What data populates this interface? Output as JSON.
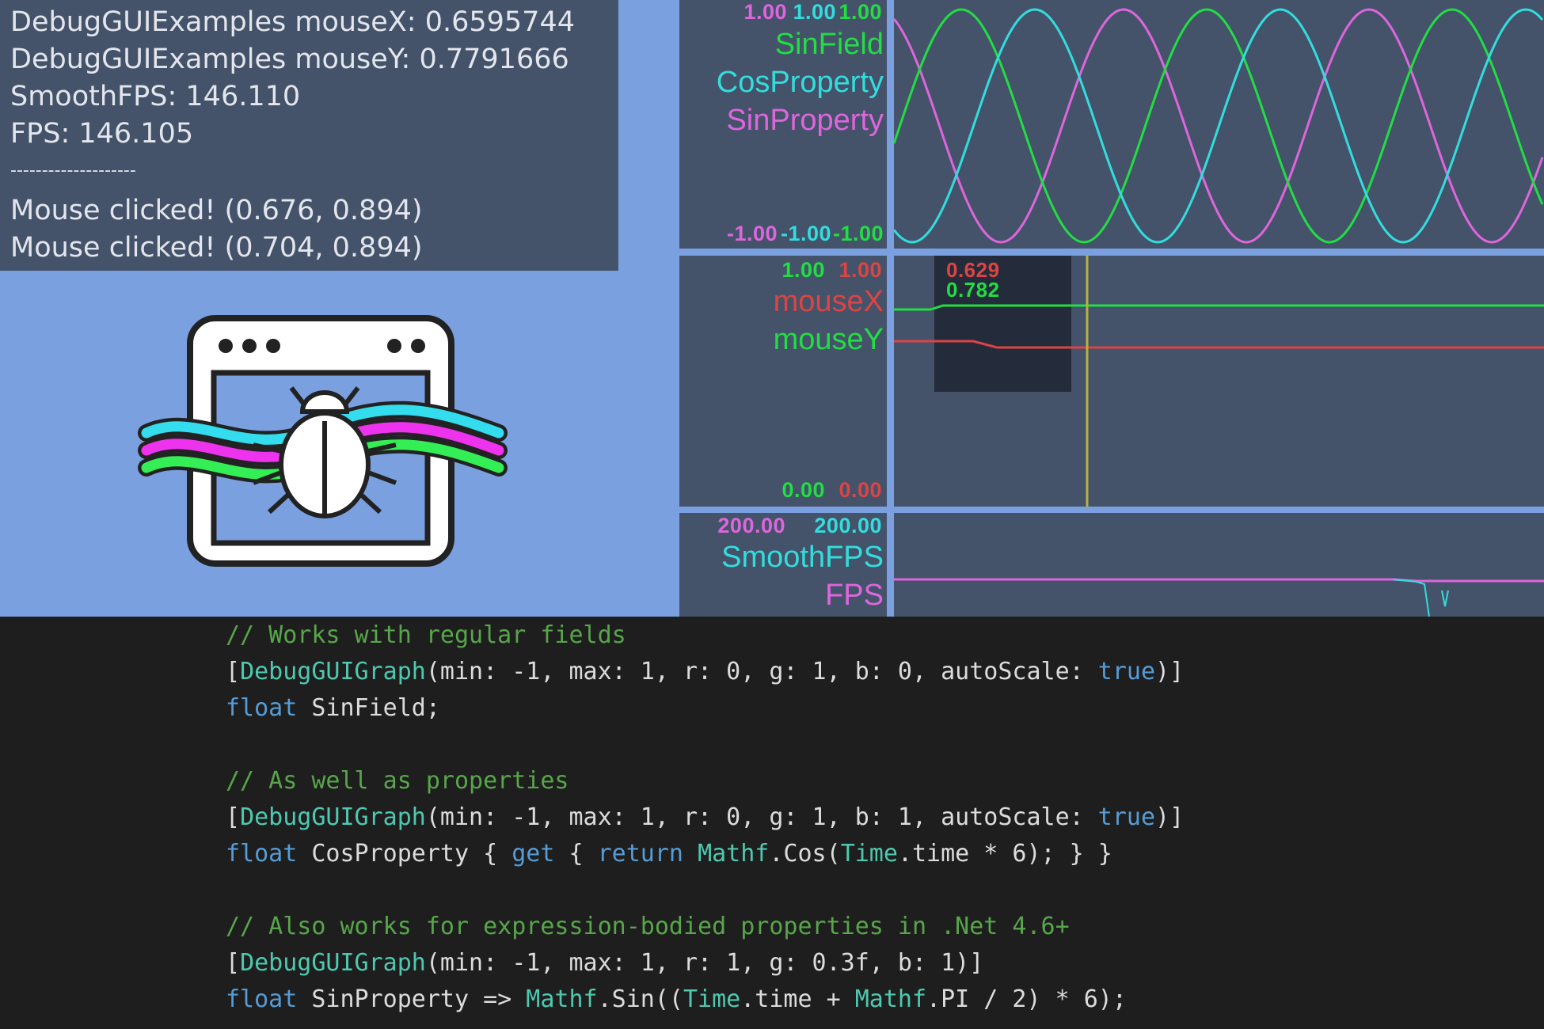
{
  "log": {
    "lines": [
      "DebugGUIExamples mouseX: 0.6595744",
      "DebugGUIExamples mouseY: 0.7791666",
      "SmoothFPS: 146.110",
      "FPS: 146.105",
      "--------------------",
      "Mouse clicked! (0.676, 0.894)",
      "Mouse clicked! (0.704, 0.894)"
    ]
  },
  "logo": {
    "icon": "debug-gui-bug-window-icon"
  },
  "graphs": {
    "sin": {
      "max_values": [
        "1.00",
        "1.00",
        "1.00"
      ],
      "min_values": [
        "-1.00",
        "-1.00",
        "-1.00"
      ],
      "labels": [
        "SinField",
        "CosProperty",
        "SinProperty"
      ],
      "colors": {
        "sinfield": "#22dd44",
        "cosproperty": "#33dddd",
        "sinproperty": "#dd66dd"
      }
    },
    "mouse": {
      "max_values": [
        "1.00",
        "1.00"
      ],
      "min_values": [
        "0.00",
        "0.00"
      ],
      "labels": [
        "mouseX",
        "mouseY"
      ],
      "hover_values": [
        "0.629",
        "0.782"
      ],
      "colors": {
        "mousex": "#dd4444",
        "mousey": "#22dd44"
      }
    },
    "fps": {
      "max_values": [
        "200.00",
        "200.00"
      ],
      "labels": [
        "SmoothFPS",
        "FPS"
      ],
      "colors": {
        "smoothfps": "#33dddd",
        "fps": "#dd66dd"
      }
    }
  },
  "code": {
    "comment1": "// Works with regular fields",
    "attr1_type": "DebugGUIGraph",
    "attr1_args": "(min: -1, max: 1, r: 0, g: 1, b: 0, autoScale: ",
    "attr1_true": "true",
    "decl1_kw": "float",
    "decl1_rest": " SinField;",
    "comment2": "// As well as properties",
    "attr2_type": "DebugGUIGraph",
    "attr2_args": "(min: -1, max: 1, r: 0, g: 1, b: 1, autoScale: ",
    "attr2_true": "true",
    "decl2_kw": "float",
    "decl2_name": " CosProperty { ",
    "decl2_get": "get",
    "decl2_brace": " { ",
    "decl2_return": "return",
    "decl2_mathf": "Mathf",
    "decl2_cos": ".Cos(",
    "decl2_time": "Time",
    "decl2_tail": ".time * 6); } }",
    "comment3": "// Also works for expression-bodied properties in .Net 4.6+",
    "attr3_type": "DebugGUIGraph",
    "attr3_args": "(min: -1, max: 1, r: 1, g: 0.3f, b: 1)]",
    "decl3_kw": "float",
    "decl3_name": " SinProperty => ",
    "decl3_mathf": "Mathf",
    "decl3_sin": ".Sin((",
    "decl3_time": "Time",
    "decl3_mid": ".time + ",
    "decl3_mathf2": "Mathf",
    "decl3_tail": ".PI / 2) * 6);"
  }
}
